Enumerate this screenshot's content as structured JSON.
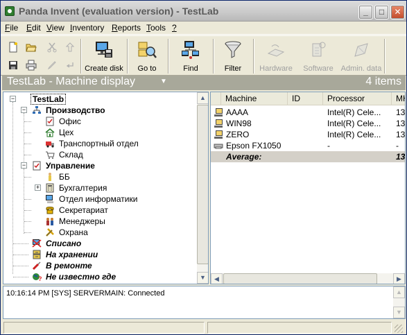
{
  "window": {
    "title": "Panda Invent (evaluation version) - TestLab",
    "minimize": "_",
    "maximize": "□",
    "close": "✕"
  },
  "menu": [
    {
      "pre": "",
      "u": "F",
      "post": "ile"
    },
    {
      "pre": "",
      "u": "E",
      "post": "dit"
    },
    {
      "pre": "",
      "u": "V",
      "post": "iew"
    },
    {
      "pre": "",
      "u": "I",
      "post": "nventory"
    },
    {
      "pre": "",
      "u": "R",
      "post": "eports"
    },
    {
      "pre": "",
      "u": "T",
      "post": "ools"
    },
    {
      "pre": "",
      "u": "?",
      "post": ""
    }
  ],
  "toolbar": {
    "create_disk": "Create disk",
    "go_to": "Go to",
    "find": "Find",
    "filter": "Filter",
    "hardware": "Hardware",
    "software": "Software",
    "admin_data": "Admin. data"
  },
  "header": {
    "title": "TestLab - Machine display",
    "caret": "▼",
    "count": "4 items"
  },
  "tree": {
    "root": "TestLab",
    "production": "Производство",
    "office": "Офис",
    "shop": "Цех",
    "transport": "Транспортный отдел",
    "warehouse": "Склад",
    "management": "Управление",
    "bb": "ББ",
    "accounting": "Бухгалтерия",
    "it_dept": "Отдел информатики",
    "secretariat": "Секретариат",
    "managers": "Менеджеры",
    "security": "Охрана",
    "written_off": "Списано",
    "in_storage": "На хранении",
    "in_repair": "В ремонте",
    "unknown": "Не известно где"
  },
  "list": {
    "columns": [
      "Machine",
      "ID",
      "Processor",
      "MHz"
    ],
    "rows": [
      {
        "machine": "AAAA",
        "id": "",
        "processor": "Intel(R) Cele...",
        "mhz": "13"
      },
      {
        "machine": "WIN98",
        "id": "",
        "processor": "Intel(R) Cele...",
        "mhz": "13"
      },
      {
        "machine": "ZERO",
        "id": "",
        "processor": "Intel(R) Cele...",
        "mhz": "13"
      },
      {
        "machine": "Epson FX1050",
        "id": "",
        "processor": "-",
        "mhz": "-"
      }
    ],
    "average_label": "Average:",
    "average_value": "13"
  },
  "log": {
    "text": "10:16:14 PM [SYS] SERVERMAIN: Connected"
  },
  "colors": {
    "header_band": "#a8a89a",
    "window_bg": "#ece9d8",
    "pane_border": "#7f9db9"
  }
}
